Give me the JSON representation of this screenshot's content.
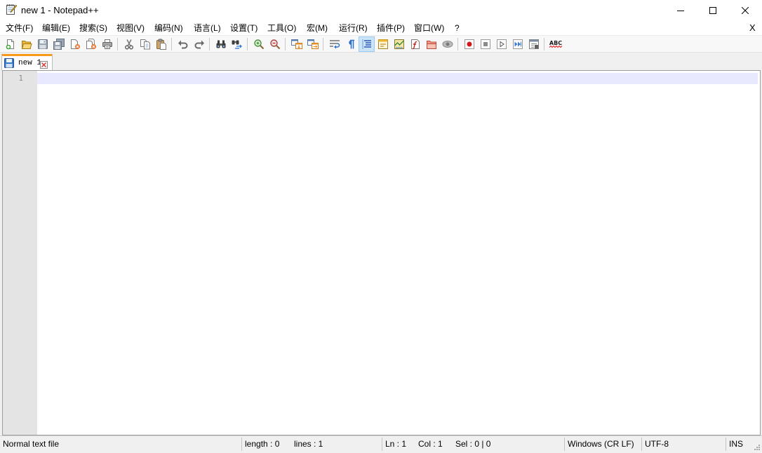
{
  "window": {
    "title": "new 1 - Notepad++",
    "app_icon": "notepad-icon",
    "controls": [
      "minimize-icon",
      "maximize-icon",
      "close-icon"
    ]
  },
  "menu": {
    "items": [
      "文件(F)",
      "编辑(E)",
      "搜索(S)",
      "视图(V)",
      "编码(N)",
      "语言(L)",
      "设置(T)",
      "工具(O)",
      "宏(M)",
      "运行(R)",
      "插件(P)",
      "窗口(W)",
      "?"
    ],
    "close_document_label": "X"
  },
  "toolbar": {
    "icons": [
      "new-file-icon",
      "open-file-icon",
      "save-icon",
      "save-all-icon",
      "close-file-icon",
      "close-all-icon",
      "print-icon",
      "cut-icon",
      "copy-icon",
      "paste-icon",
      "undo-icon",
      "redo-icon",
      "find-icon",
      "replace-icon",
      "zoom-in-icon",
      "zoom-out-icon",
      "sync-vertical-scroll-icon",
      "sync-horizontal-scroll-icon",
      "word-wrap-icon",
      "show-all-characters-icon",
      "indent-guide-icon",
      "user-defined-language-icon",
      "document-map-icon",
      "function-list-icon",
      "folder-as-workspace-icon",
      "monitoring-icon",
      "record-macro-icon",
      "stop-recording-icon",
      "playback-macro-icon",
      "run-macro-multiple-icon",
      "save-macro-icon",
      "spell-check-icon"
    ],
    "active": "indent-guide-icon",
    "spellcheck_text": "ABC"
  },
  "tabs": [
    {
      "label": "new 1",
      "active": true,
      "icon": "save-status-icon",
      "close_icon": "tab-close-icon"
    }
  ],
  "editor": {
    "line_numbers": [
      "1"
    ]
  },
  "status": {
    "file_type": "Normal text file",
    "length": "length : 0",
    "lines": "lines : 1",
    "ln": "Ln : 1",
    "col": "Col : 1",
    "sel": "Sel : 0 | 0",
    "eol": "Windows (CR LF)",
    "encoding": "UTF-8",
    "mode": "INS"
  },
  "colors": {
    "tab_accent": "#fa9a1a",
    "current_line_highlight": "#e8e8ff",
    "line_number_margin": "#e4e4e4",
    "active_tool_background": "#cce4f7"
  }
}
